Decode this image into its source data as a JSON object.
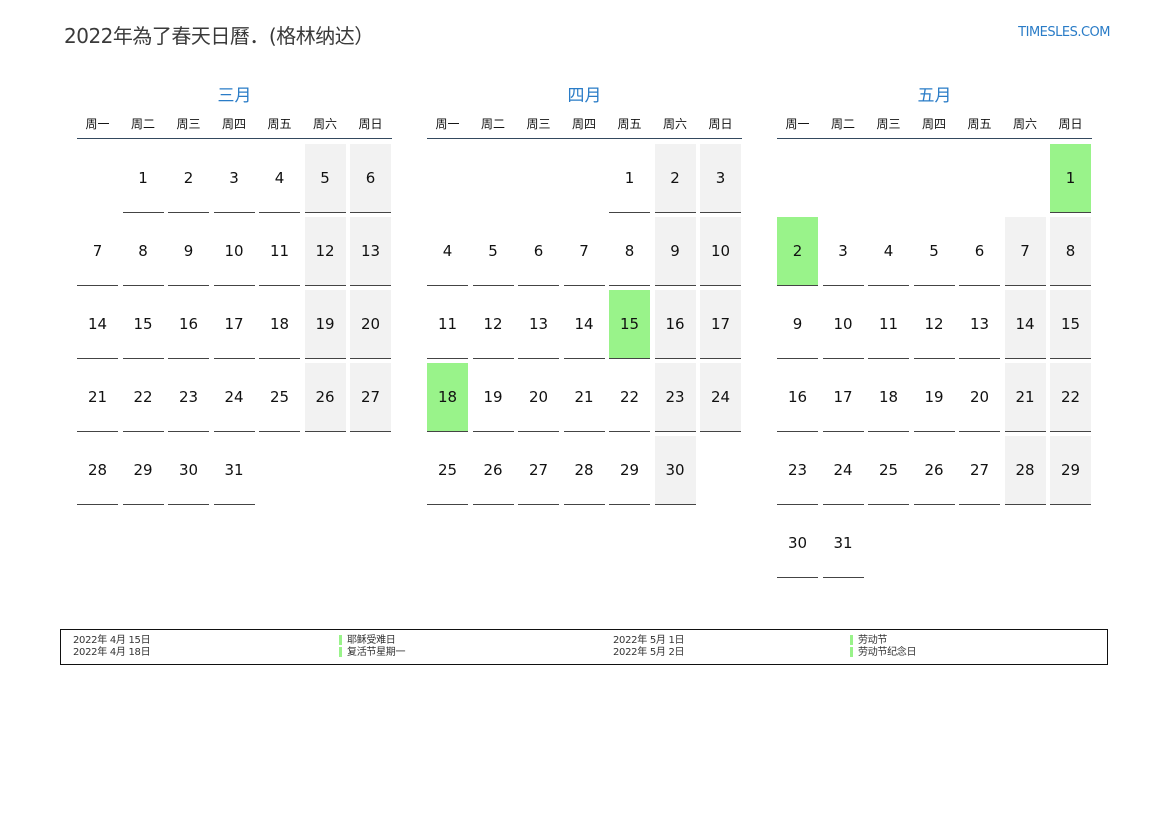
{
  "header": {
    "title": "2022年為了春天日曆．(格林纳达）",
    "brand": "TIMESLES.COM"
  },
  "weekdays": [
    "周一",
    "周二",
    "周三",
    "周四",
    "周五",
    "周六",
    "周日"
  ],
  "months": [
    {
      "name": "三月",
      "weeks": [
        [
          "",
          "1",
          "2",
          "3",
          "4",
          "5",
          "6"
        ],
        [
          "7",
          "8",
          "9",
          "10",
          "11",
          "12",
          "13"
        ],
        [
          "14",
          "15",
          "16",
          "17",
          "18",
          "19",
          "20"
        ],
        [
          "21",
          "22",
          "23",
          "24",
          "25",
          "26",
          "27"
        ],
        [
          "28",
          "29",
          "30",
          "31",
          "",
          "",
          ""
        ]
      ],
      "holidays": []
    },
    {
      "name": "四月",
      "weeks": [
        [
          "",
          "",
          "",
          "",
          "1",
          "2",
          "3"
        ],
        [
          "4",
          "5",
          "6",
          "7",
          "8",
          "9",
          "10"
        ],
        [
          "11",
          "12",
          "13",
          "14",
          "15",
          "16",
          "17"
        ],
        [
          "18",
          "19",
          "20",
          "21",
          "22",
          "23",
          "24"
        ],
        [
          "25",
          "26",
          "27",
          "28",
          "29",
          "30",
          ""
        ]
      ],
      "holidays": [
        "15",
        "18"
      ]
    },
    {
      "name": "五月",
      "weeks": [
        [
          "",
          "",
          "",
          "",
          "",
          "",
          "1"
        ],
        [
          "2",
          "3",
          "4",
          "5",
          "6",
          "7",
          "8"
        ],
        [
          "9",
          "10",
          "11",
          "12",
          "13",
          "14",
          "15"
        ],
        [
          "16",
          "17",
          "18",
          "19",
          "20",
          "21",
          "22"
        ],
        [
          "23",
          "24",
          "25",
          "26",
          "27",
          "28",
          "29"
        ],
        [
          "30",
          "31",
          "",
          "",
          "",
          "",
          ""
        ]
      ],
      "holidays": [
        "1",
        "2"
      ]
    }
  ],
  "holiday_color": "#99f38a",
  "weekend_color": "#f2f2f2",
  "accent_color": "#2a7cc7",
  "legend": {
    "left": [
      {
        "date": "2022年 4月 15日",
        "name": "耶稣受难日"
      },
      {
        "date": "2022年 4月 18日",
        "name": "复活节星期一"
      }
    ],
    "right": [
      {
        "date": "2022年 5月 1日",
        "name": "劳动节"
      },
      {
        "date": "2022年 5月 2日",
        "name": "劳动节纪念日"
      }
    ]
  }
}
